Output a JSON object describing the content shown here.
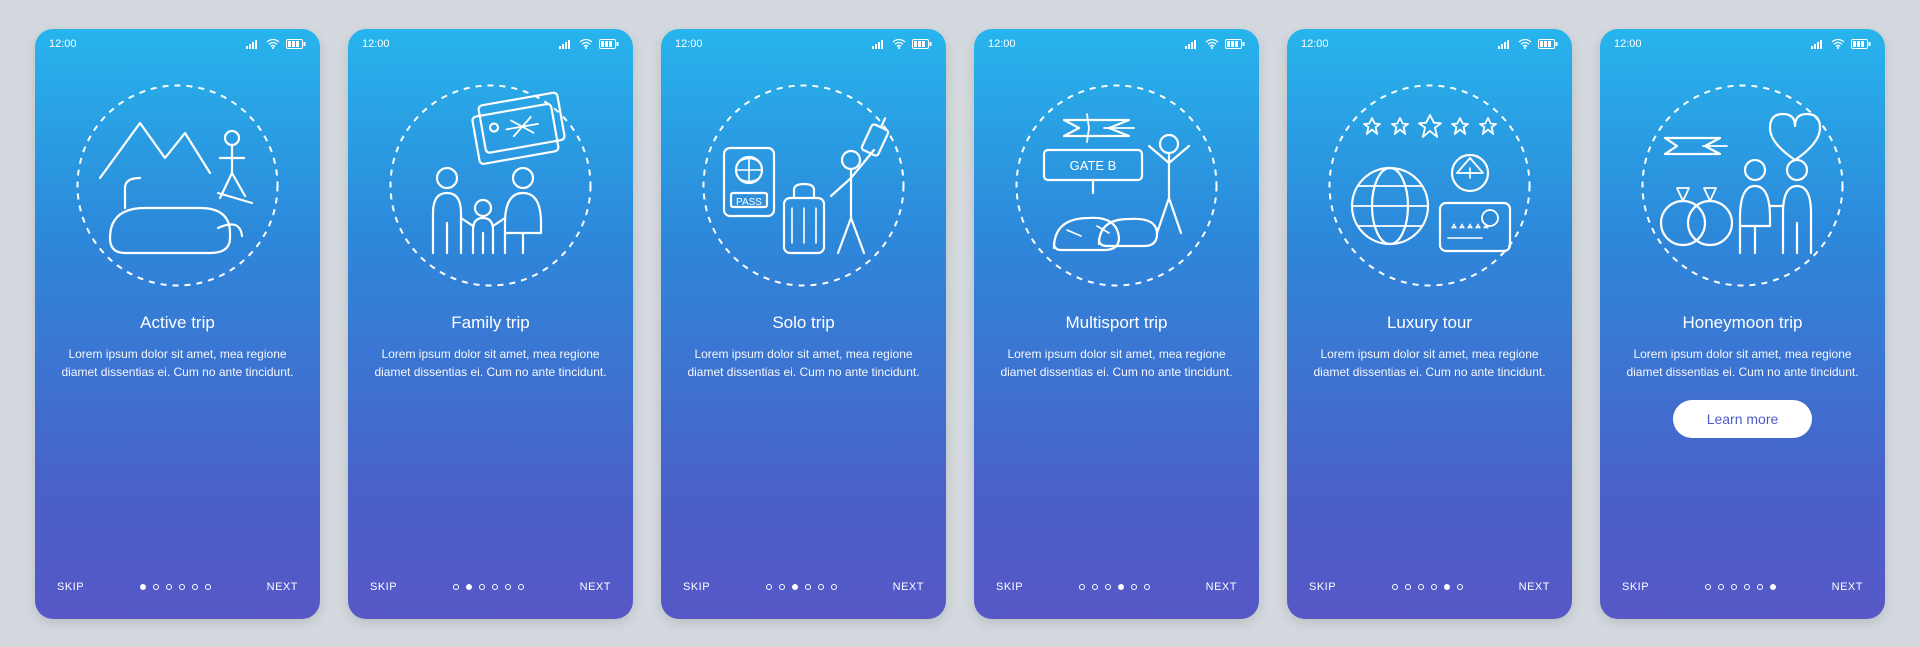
{
  "status": {
    "time": "12:00",
    "signal_icon": "signal",
    "wifi_icon": "wifi",
    "battery_icon": "battery"
  },
  "lorem": "Lorem ipsum dolor sit amet, mea regione diamet dissentias ei. Cum no ante tincidunt.",
  "nav": {
    "skip": "SKIP",
    "next": "NEXT"
  },
  "learn_more": "Learn more",
  "screens": [
    {
      "title": "Active trip",
      "icon": "active",
      "active_dot": 0
    },
    {
      "title": "Family trip",
      "icon": "family",
      "active_dot": 1
    },
    {
      "title": "Solo trip",
      "icon": "solo",
      "active_dot": 2
    },
    {
      "title": "Multisport trip",
      "icon": "multisport",
      "active_dot": 3
    },
    {
      "title": "Luxury tour",
      "icon": "luxury",
      "active_dot": 4
    },
    {
      "title": "Honeymoon trip",
      "icon": "honeymoon",
      "active_dot": 5
    }
  ],
  "dot_count": 6,
  "gate_label": "GATE B",
  "pass_label": "PASS"
}
